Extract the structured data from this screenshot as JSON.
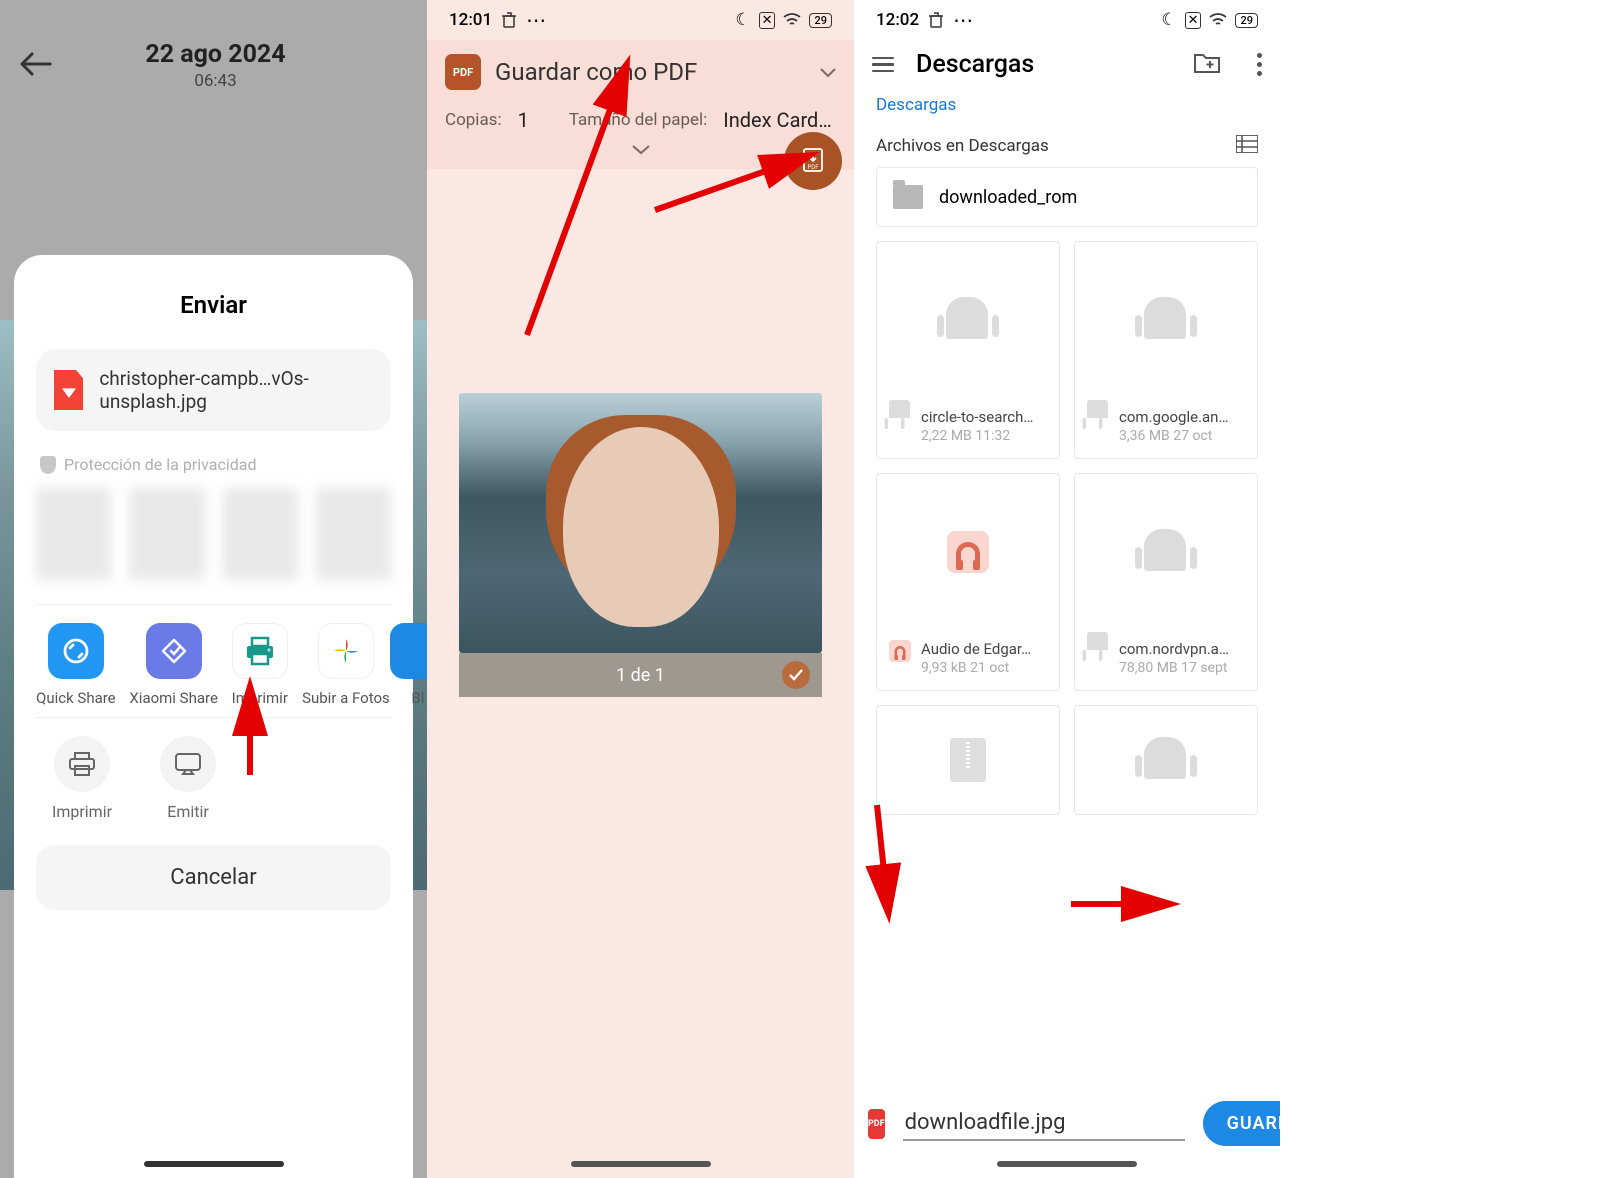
{
  "screen1": {
    "date": "22 ago 2024",
    "time": "06:43",
    "sheet_title": "Enviar",
    "file_name": "christopher-campb…vOs-unsplash.jpg",
    "privacy": "Protección de la privacidad",
    "apps": {
      "quick_share": "Quick Share",
      "xiaomi_share": "Xiaomi Share",
      "imprimir": "Imprimir",
      "fotos": "Subir a Fotos",
      "bl": "Bl"
    },
    "sys": {
      "imprimir": "Imprimir",
      "emitir": "Emitir"
    },
    "cancel": "Cancelar"
  },
  "screen2": {
    "time": "12:01",
    "battery": "29",
    "title": "Guardar como PDF",
    "copies_label": "Copias:",
    "copies_value": "1",
    "paper_label": "Tamaño del papel:",
    "paper_value": "Index Card…",
    "page_indicator": "1 de 1"
  },
  "screen3": {
    "time": "12:02",
    "battery": "29",
    "title": "Descargas",
    "breadcrumb": "Descargas",
    "section": "Archivos en Descargas",
    "folder": "downloaded_rom",
    "files": [
      {
        "name": "circle-to-search…",
        "sub": "2,22 MB  11:32"
      },
      {
        "name": "com.google.an…",
        "sub": "3,36 MB  27 oct"
      },
      {
        "name": "Audio de Edgar…",
        "sub": "9,93 kB  21 oct"
      },
      {
        "name": "com.nordvpn.a…",
        "sub": "78,80 MB  17 sept"
      }
    ],
    "filename_input": "downloadfile.jpg",
    "save": "GUARDAR"
  }
}
